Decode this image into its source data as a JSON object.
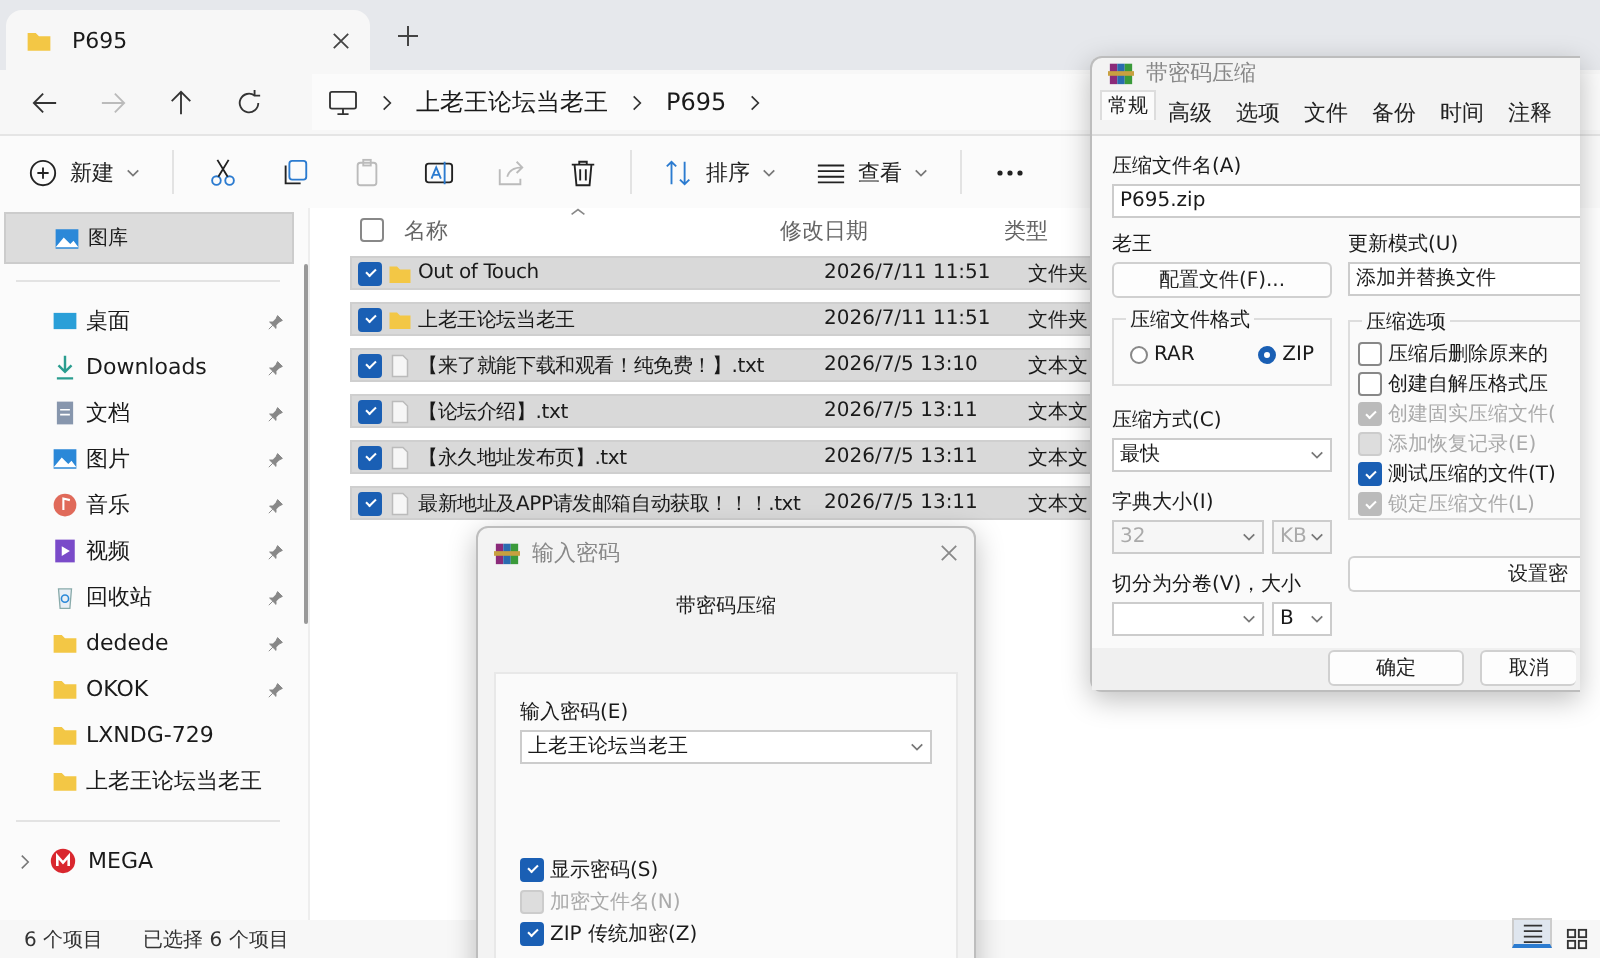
{
  "explorer": {
    "tab": {
      "title": "P695"
    },
    "breadcrumb": [
      "上老王论坛当老王",
      "P695"
    ],
    "toolbar": [
      {
        "kind": "new",
        "label": "新建",
        "disabled": false
      },
      {
        "kind": "cut",
        "disabled": false
      },
      {
        "kind": "copy",
        "disabled": false
      },
      {
        "kind": "paste",
        "disabled": true
      },
      {
        "kind": "rename",
        "disabled": false
      },
      {
        "kind": "share",
        "disabled": true
      },
      {
        "kind": "delete",
        "disabled": false
      },
      {
        "kind": "sort",
        "label": "排序",
        "disabled": false
      },
      {
        "kind": "view",
        "label": "查看",
        "disabled": false
      },
      {
        "kind": "more",
        "disabled": false
      }
    ],
    "sidebar": {
      "top": {
        "kind": "gallery",
        "label": "图库",
        "selected": true
      },
      "items": [
        {
          "kind": "desktop",
          "label": "桌面",
          "pinned": true,
          "selected": false
        },
        {
          "kind": "download",
          "label": "Downloads",
          "pinned": true,
          "selected": false
        },
        {
          "kind": "documents",
          "label": "文档",
          "pinned": true,
          "selected": false
        },
        {
          "kind": "pictures",
          "label": "图片",
          "pinned": true,
          "selected": false
        },
        {
          "kind": "music",
          "label": "音乐",
          "pinned": true,
          "selected": false
        },
        {
          "kind": "videos",
          "label": "视频",
          "pinned": true,
          "selected": false
        },
        {
          "kind": "recycle",
          "label": "回收站",
          "pinned": true,
          "selected": false
        },
        {
          "kind": "folder",
          "label": "dedede",
          "pinned": true,
          "selected": false
        },
        {
          "kind": "folder",
          "label": "OKOK",
          "pinned": true,
          "selected": false
        },
        {
          "kind": "folder",
          "label": "LXNDG-729",
          "pinned": false,
          "selected": false
        },
        {
          "kind": "folder",
          "label": "上老王论坛当老王",
          "pinned": false,
          "selected": false
        }
      ],
      "footer": {
        "label": "MEGA",
        "expanded": false
      }
    },
    "columns": [
      "名称",
      "修改日期",
      "类型"
    ],
    "select_all_checked": false,
    "files": [
      {
        "kind": "folder",
        "name": "Out of Touch",
        "modified": "2026/7/11 11:51",
        "type": "文件夹",
        "selected": true
      },
      {
        "kind": "folder",
        "name": "上老王论坛当老王",
        "modified": "2026/7/11 11:51",
        "type": "文件夹",
        "selected": true
      },
      {
        "kind": "text",
        "name": "【来了就能下载和观看！纯免费！】.txt",
        "modified": "2026/7/5 13:10",
        "type": "文本文",
        "selected": true
      },
      {
        "kind": "text",
        "name": "【论坛介绍】.txt",
        "modified": "2026/7/5 13:11",
        "type": "文本文",
        "selected": true
      },
      {
        "kind": "text",
        "name": "【永久地址发布页】.txt",
        "modified": "2026/7/5 13:11",
        "type": "文本文",
        "selected": true
      },
      {
        "kind": "text",
        "name": "最新地址及APP请发邮箱自动获取！！！.txt",
        "modified": "2026/7/5 13:11",
        "type": "文本文",
        "selected": true
      }
    ],
    "status_bar": {
      "count": "6 个项目",
      "selection": "已选择 6 个项目",
      "views": [
        {
          "kind": "details",
          "selected": true
        },
        {
          "kind": "tiles",
          "selected": false
        }
      ]
    }
  },
  "archive_dialog": {
    "title": "带密码压缩",
    "tabs": [
      {
        "label": "常规",
        "selected": true
      },
      {
        "label": "高级",
        "selected": false
      },
      {
        "label": "选项",
        "selected": false
      },
      {
        "label": "文件",
        "selected": false
      },
      {
        "label": "备份",
        "selected": false
      },
      {
        "label": "时间",
        "selected": false
      },
      {
        "label": "注释",
        "selected": false
      }
    ],
    "name_label": "压缩文件名(A)",
    "name_value": "P695.zip",
    "profile_label": "老王",
    "profile_button": "配置文件(F)...",
    "update_label": "更新模式(U)",
    "update_value": "添加并替换文件",
    "format_label": "压缩文件格式",
    "formats": [
      {
        "label": "RAR",
        "selected": false
      },
      {
        "label": "ZIP",
        "selected": true
      }
    ],
    "method_label": "压缩方式(C)",
    "method_value": "最快",
    "dict_label": "字典大小(I)",
    "dict_value": "32",
    "dict_unit": "KB",
    "dict_disabled": true,
    "split_label": "切分为分卷(V)，大小",
    "split_unit": "B",
    "options_label": "压缩选项",
    "options": [
      {
        "label": "压缩后删除原来的",
        "checked": false,
        "disabled": false
      },
      {
        "label": "创建自解压格式压",
        "checked": false,
        "disabled": false
      },
      {
        "label": "创建固实压缩文件(",
        "checked": true,
        "disabled": true
      },
      {
        "label": "添加恢复记录(E)",
        "checked": false,
        "disabled": true
      },
      {
        "label": "测试压缩的文件(T)",
        "checked": true,
        "disabled": false
      },
      {
        "label": "锁定压缩文件(L)",
        "checked": true,
        "disabled": true
      }
    ],
    "password_button": "设置密",
    "ok": "确定",
    "cancel": "取消"
  },
  "password_dialog": {
    "title": "输入密码",
    "heading": "带密码压缩",
    "field_label": "输入密码(E)",
    "field_value": "上老王论坛当老王",
    "options": [
      {
        "label": "显示密码(S)",
        "checked": true,
        "disabled": false
      },
      {
        "label": "加密文件名(N)",
        "checked": false,
        "disabled": true
      },
      {
        "label": "ZIP 传统加密(Z)",
        "checked": true,
        "disabled": false
      }
    ]
  }
}
